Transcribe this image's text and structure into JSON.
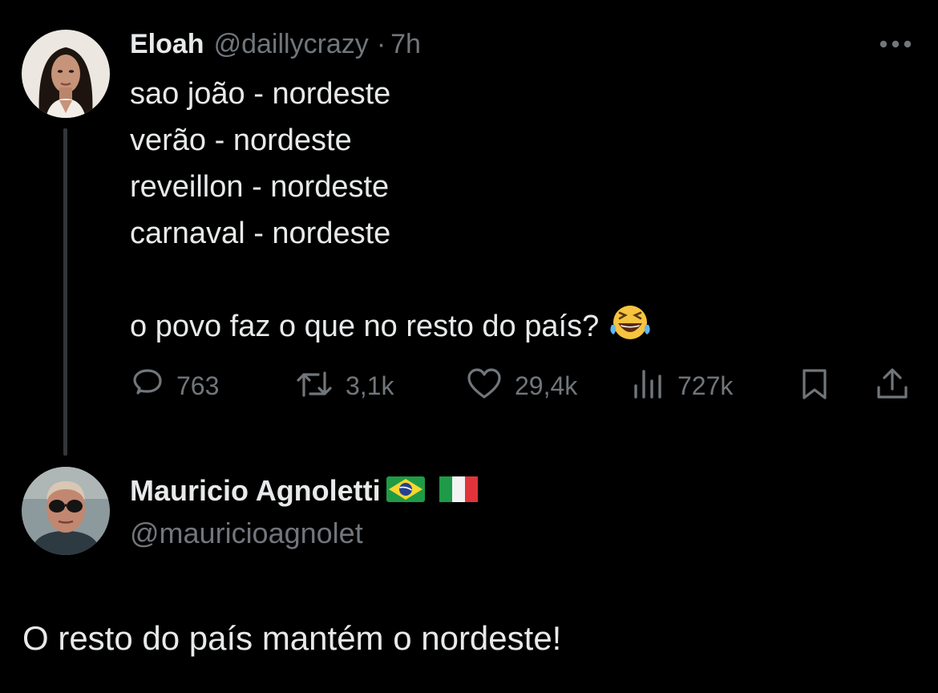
{
  "tweet": {
    "author_name": "Eloah",
    "author_handle": "@daillycrazy",
    "separator": "·",
    "time": "7h",
    "lines": [
      "sao joão - nordeste",
      "verão - nordeste",
      "reveillon - nordeste",
      "carnaval - nordeste",
      "",
      "o povo faz o que no resto do país?"
    ],
    "emoji": "face-with-tears-of-joy",
    "stats": {
      "replies": "763",
      "retweets": "3,1k",
      "likes": "29,4k",
      "views": "727k"
    },
    "icons": {
      "reply": "reply-bubble-icon",
      "retweet": "retweet-icon",
      "like": "heart-icon",
      "views": "views-bar-chart-icon",
      "bookmark": "bookmark-icon",
      "share": "share-icon",
      "more": "more-dots-icon"
    }
  },
  "reply": {
    "author_name": "Mauricio Agnoletti",
    "flags": [
      "brazil-flag",
      "italy-flag"
    ],
    "author_handle": "@mauricioagnolet",
    "text": "O resto do país mantém o nordeste!"
  },
  "colors": {
    "background": "#000000",
    "text_primary": "#e7e9ea",
    "text_secondary": "#71767b",
    "thread_line": "#333639"
  }
}
